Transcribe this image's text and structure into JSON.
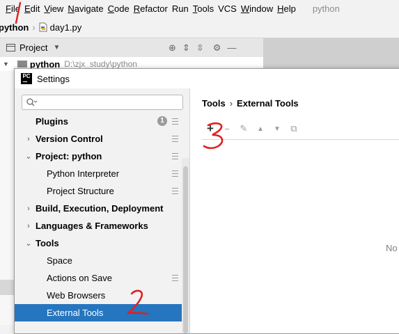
{
  "menubar": {
    "items": [
      {
        "text": "File",
        "mnemonic": "F",
        "rest": "ile"
      },
      {
        "text": "Edit",
        "mnemonic": "E",
        "rest": "dit"
      },
      {
        "text": "View",
        "mnemonic": "V",
        "rest": "iew"
      },
      {
        "text": "Navigate",
        "mnemonic": "N",
        "rest": "avigate"
      },
      {
        "text": "Code",
        "mnemonic": "C",
        "rest": "ode"
      },
      {
        "text": "Refactor",
        "mnemonic": "R",
        "rest": "efactor"
      },
      {
        "text": "Run",
        "mnemonic": "",
        "rest": "Run"
      },
      {
        "text": "Tools",
        "mnemonic": "T",
        "rest": "ools"
      },
      {
        "text": "VCS",
        "mnemonic": "",
        "rest": "VCS"
      },
      {
        "text": "Window",
        "mnemonic": "W",
        "rest": "indow"
      },
      {
        "text": "Help",
        "mnemonic": "H",
        "rest": "elp"
      }
    ],
    "project_name": "python"
  },
  "navbar": {
    "root": "python",
    "file": "day1.py"
  },
  "project_window": {
    "title": "Project",
    "tree_root": {
      "name": "python",
      "path": "D:\\zjx_study\\python"
    }
  },
  "settings": {
    "title": "Settings",
    "logo_text": "PC",
    "search": {
      "placeholder": "",
      "value": ""
    },
    "tree": [
      {
        "label": "Plugins",
        "kind": "group",
        "chevron": "",
        "info_badge": "1",
        "side_icon": true
      },
      {
        "label": "Version Control",
        "kind": "group",
        "chevron": "›",
        "side_icon": true
      },
      {
        "label": "Project: python",
        "kind": "group",
        "chevron": "⌄",
        "side_icon": true
      },
      {
        "label": "Python Interpreter",
        "kind": "child",
        "side_icon": true
      },
      {
        "label": "Project Structure",
        "kind": "child",
        "side_icon": true
      },
      {
        "label": "Build, Execution, Deployment",
        "kind": "group",
        "chevron": "›",
        "side_icon": false
      },
      {
        "label": "Languages & Frameworks",
        "kind": "group",
        "chevron": "›",
        "side_icon": false
      },
      {
        "label": "Tools",
        "kind": "group",
        "chevron": "⌄",
        "side_icon": false
      },
      {
        "label": "Space",
        "kind": "child",
        "side_icon": false
      },
      {
        "label": "Actions on Save",
        "kind": "child",
        "side_icon": true
      },
      {
        "label": "Web Browsers",
        "kind": "child",
        "side_icon": false
      },
      {
        "label": "External Tools",
        "kind": "child",
        "side_icon": false,
        "selected": true
      }
    ],
    "breadcrumb": {
      "parent": "Tools",
      "separator": "›",
      "current": "External Tools"
    },
    "toolbar": {
      "add": "+",
      "remove": "−",
      "edit": "✎",
      "up": "▲",
      "down": "▼",
      "copy": "⧉"
    },
    "empty_text": "No"
  },
  "annotations": {
    "one": "1",
    "two": "2",
    "three": "3"
  },
  "colors": {
    "selection": "#2675bf",
    "annotation": "#e02020"
  }
}
